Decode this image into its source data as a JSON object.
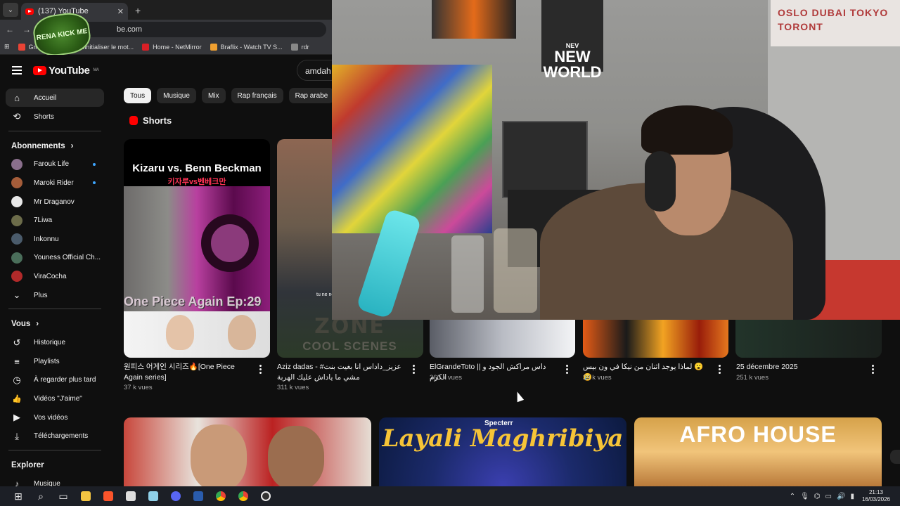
{
  "browser": {
    "tab_title": "(137) YouTube",
    "url": "be.com",
    "bookmarks": [
      {
        "label": "Gm",
        "color": "#ea4335"
      },
      {
        "label": "",
        "color": "#888888"
      },
      {
        "label": "Réinitialiser le mot...",
        "color": "#e1306c"
      },
      {
        "label": "Home - NetMirror",
        "color": "#d81f26"
      },
      {
        "label": "Braflix - Watch TV S...",
        "color": "#f0a030"
      },
      {
        "label": "rdr",
        "color": "#888888"
      }
    ],
    "badge_text": "RENA KICK ME"
  },
  "youtube": {
    "logo_text": "YouTube",
    "region": "MA",
    "search_value": "amdah r"
  },
  "sidebar": {
    "main": [
      {
        "label": "Accueil",
        "icon": "home-icon",
        "glyph": "⌂",
        "active": true
      },
      {
        "label": "Shorts",
        "icon": "shorts-icon",
        "glyph": "⟲"
      }
    ],
    "subs_header": "Abonnements",
    "subs": [
      {
        "label": "Farouk Life",
        "color": "#8a6f8c",
        "dot": true
      },
      {
        "label": "Maroki Rider",
        "color": "#a55d3a",
        "dot": true
      },
      {
        "label": "Mr Draganov",
        "color": "#e8e8e8",
        "dot": false
      },
      {
        "label": "7Liwa",
        "color": "#6c6c4a",
        "dot": false
      },
      {
        "label": "Inkonnu",
        "color": "#4a5b6b",
        "dot": false
      },
      {
        "label": "Youness Official Ch...",
        "color": "#4a6e5a",
        "dot": false
      },
      {
        "label": "ViraCocha",
        "color": "#b22a2a",
        "dot": false
      },
      {
        "label": "Plus",
        "color": "",
        "dot": false
      }
    ],
    "you_header": "Vous",
    "you": [
      {
        "label": "Historique",
        "icon": "history-icon",
        "glyph": "↺"
      },
      {
        "label": "Playlists",
        "icon": "playlists-icon",
        "glyph": "≡"
      },
      {
        "label": "À regarder plus tard",
        "icon": "watch-later-icon",
        "glyph": "◷"
      },
      {
        "label": "Vidéos \"J'aime\"",
        "icon": "like-icon",
        "glyph": "👍"
      },
      {
        "label": "Vos vidéos",
        "icon": "your-videos-icon",
        "glyph": "▶"
      },
      {
        "label": "Téléchargements",
        "icon": "download-icon",
        "glyph": "⤓"
      }
    ],
    "explore_header": "Explorer",
    "explore": [
      {
        "label": "Musique",
        "icon": "music-icon",
        "glyph": "♪"
      }
    ]
  },
  "chips": [
    "Tous",
    "Musique",
    "Mix",
    "Rap français",
    "Rap arabe"
  ],
  "shorts": {
    "header": "Shorts",
    "card1_title_a": "Kizaru vs. Benn Beckman",
    "card1_title_b": "키자루vs벤베크만",
    "card1_caption": "One Piece Again Ep:29",
    "card2_small": "tu ne no",
    "card2_zone_a": "ZONE",
    "card2_zone_b": "COOL SCENES",
    "items": [
      {
        "title": "원피스 어게인 시리즈🔥[One Piece Again series]",
        "views": "37 k vues"
      },
      {
        "title": "Aziz dadas - #عزيز_داداس انا بغيت بنت مشي ما ياداش عليك الهربة",
        "views": "311 k vues"
      },
      {
        "title": "ElGrandeToto || داس مراكش الجود و الكرم",
        "views": "360 k vues"
      },
      {
        "title": "لماذا يوجد اثنان من نيكا في ون بيس 😮 😢",
        "views": "39 k vues"
      },
      {
        "title": "25 décembre 2025",
        "views": "251 k vues"
      }
    ]
  },
  "thumbs": {
    "t2_brand": "Specterr",
    "t2_title": "Layali Maghribiya",
    "t3_title": "AFRO HOUSE"
  },
  "webcam": {
    "poster_text": "NEW WORLD",
    "poster_small": "NEV",
    "map_text": "OSLO DUBAI TOKYO TORONT"
  },
  "taskbar": {
    "time": "21:13",
    "date": "16/03/2026"
  }
}
